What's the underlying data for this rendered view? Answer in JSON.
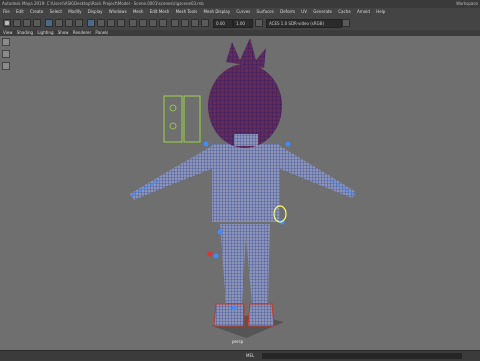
{
  "window": {
    "title": "Autodesk Maya 2019: C:\\Users\\ASK\\Desktop\\Rock Project\\Model - Scene.0001\\scenes\\rigscene03.mb",
    "right_label": "Workspace"
  },
  "menu": {
    "items": [
      "File",
      "Edit",
      "Create",
      "Select",
      "Modify",
      "Display",
      "Windows",
      "Mesh",
      "Edit Mesh",
      "Mesh Tools",
      "Mesh Display",
      "Curves",
      "Surfaces",
      "Deform",
      "UV",
      "Generate",
      "Cache",
      "Arnold",
      "Help"
    ]
  },
  "toolbar": {
    "field1": "0.00",
    "field2": "1.00",
    "info": "ACES 1.0 SDR-video (sRGB)"
  },
  "panel_menu": {
    "items": [
      "View",
      "Shading",
      "Lighting",
      "Show",
      "Renderer",
      "Panels"
    ]
  },
  "viewport": {
    "camera_label": "persp",
    "background": "#6f6f6f"
  },
  "command_line": {
    "label": "MEL"
  },
  "colors": {
    "wire": "#2b3a8c",
    "hair": "#5a1e3a",
    "control": "#3f8cff",
    "selected": "#ffff66"
  }
}
